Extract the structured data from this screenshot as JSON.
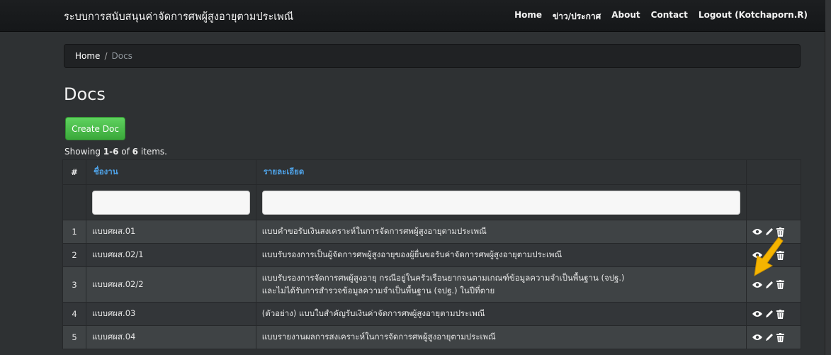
{
  "app": {
    "title": "ระบบการสนับสนุนค่าจัดการศพผู้สูงอายุตามประเพณี"
  },
  "nav": {
    "items": [
      "Home",
      "ข่าว/ประกาศ",
      "About",
      "Contact",
      "Logout (Kotchaporn.R)"
    ]
  },
  "breadcrumb": {
    "home": "Home",
    "separator": "/",
    "current": "Docs"
  },
  "page": {
    "title": "Docs",
    "create_label": "Create Doc"
  },
  "summary": {
    "prefix": "Showing ",
    "range": "1-6",
    "middle": " of ",
    "total": "6",
    "suffix": " items."
  },
  "table": {
    "columns": [
      "#",
      "ชื่องาน",
      "รายละเอียด"
    ],
    "filter_values": [
      "",
      ""
    ],
    "rows": [
      {
        "num": "1",
        "name": "แบบศผส.01",
        "detail": [
          "แบบคำขอรับเงินสงเคราะห์ในการจัดการศพผู้สูงอายุตามประเพณี"
        ]
      },
      {
        "num": "2",
        "name": "แบบศผส.02/1",
        "detail": [
          "แบบรับรองการเป็นผู้จัดการศพผู้สูงอายุของผู้ยื่นขอรับค่าจัดการศพผู้สูงอายุตามประเพณี"
        ]
      },
      {
        "num": "3",
        "name": "แบบศผส.02/2",
        "detail": [
          "แบบรับรองการจัดการศพผู้สูงอายุ กรณีอยู่ในครัวเรือนยากจนตามเกณฑ์ข้อมูลความจำเป็นพื้นฐาน (จปฐ.)",
          "และไม่ได้รับการสำรวจข้อมูลความจำเป็นพื้นฐาน (จปฐ.) ในปีที่ตาย"
        ]
      },
      {
        "num": "4",
        "name": "แบบศผส.03",
        "detail": [
          "(ตัวอย่าง) แบบใบสำคัญรับเงินค่าจัดการศพผู้สูงอายุตามประเพณี"
        ]
      },
      {
        "num": "5",
        "name": "แบบศผส.04",
        "detail": [
          "แบบรายงานผลการสงเคราะห์ในการจัดการศพผู้สูงอายุตามประเพณี"
        ]
      }
    ],
    "action_icons": [
      "eye-icon",
      "pencil-icon",
      "trash-icon"
    ]
  },
  "colors": {
    "accent_link": "#4fa3e8",
    "create_button": "#4cbf4c",
    "highlight_arrow": "#f5b400"
  }
}
